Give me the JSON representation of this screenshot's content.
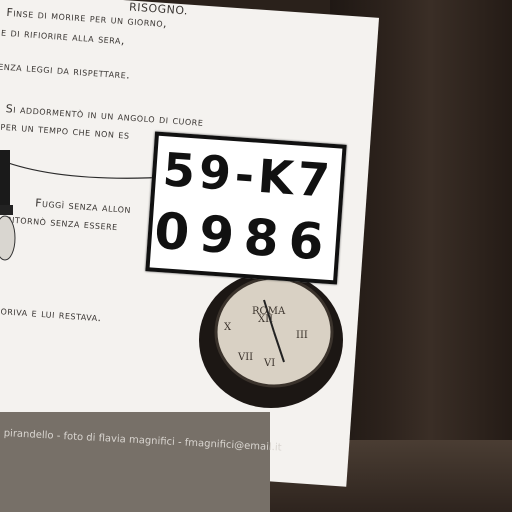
{
  "poster": {
    "lines": [
      "RISOGNO.",
      "Finse di morire per un giorno,",
      "e di rifiorire alla sera,",
      "senza leggi da rispettare.",
      "Si addormentò in un angolo di cuore",
      "per un tempo che non es",
      "Fuggì senza allon",
      "ritornò senza essere",
      "mpo moriva e lui restava."
    ],
    "footer": "pirandello - foto di flavia magnifici - fmagnifici@email.it"
  },
  "plate": {
    "line1": "59-K7",
    "line2": "0986"
  },
  "clock": {
    "brand": "ROMA"
  }
}
